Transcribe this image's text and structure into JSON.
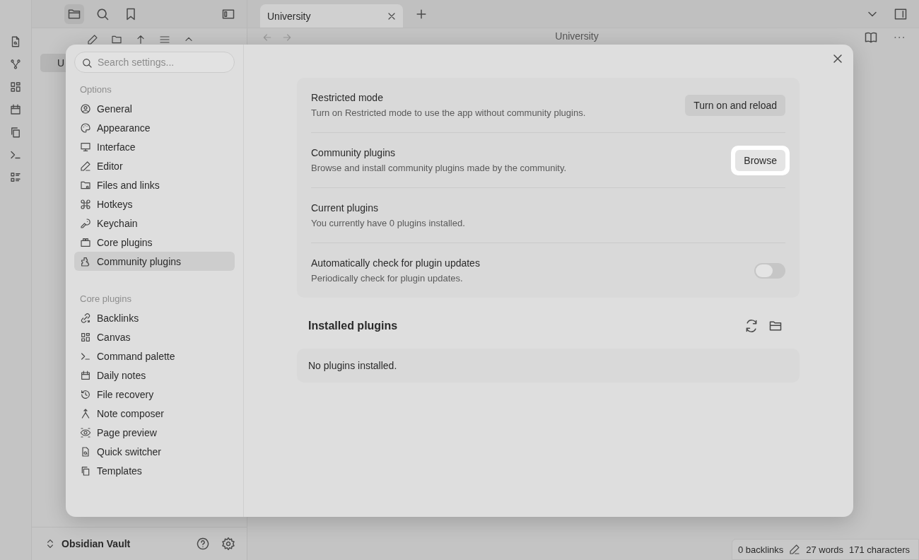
{
  "top_bar": {
    "tabs": [
      {
        "title": "University",
        "selected": true
      }
    ]
  },
  "view_header": {
    "title": "University"
  },
  "file_tree": [
    {
      "label": "U",
      "selected": true
    }
  ],
  "vault": {
    "name": "Obsidian Vault"
  },
  "status_bar": [
    "0 backlinks",
    "27 words",
    "171 characters"
  ],
  "settings": {
    "search": {
      "placeholder": "Search settings..."
    },
    "groups": [
      {
        "heading": "Options",
        "items": [
          {
            "label": "General",
            "selected": false
          },
          {
            "label": "Appearance",
            "selected": false
          },
          {
            "label": "Interface",
            "selected": false
          },
          {
            "label": "Editor",
            "selected": false
          },
          {
            "label": "Files and links",
            "selected": false
          },
          {
            "label": "Hotkeys",
            "selected": false
          },
          {
            "label": "Keychain",
            "selected": false
          },
          {
            "label": "Core plugins",
            "selected": false
          },
          {
            "label": "Community plugins",
            "selected": true
          }
        ]
      },
      {
        "heading": "Core plugins",
        "items": [
          {
            "label": "Backlinks",
            "selected": false
          },
          {
            "label": "Canvas",
            "selected": false
          },
          {
            "label": "Command palette",
            "selected": false
          },
          {
            "label": "Daily notes",
            "selected": false
          },
          {
            "label": "File recovery",
            "selected": false
          },
          {
            "label": "Note composer",
            "selected": false
          },
          {
            "label": "Page preview",
            "selected": false
          },
          {
            "label": "Quick switcher",
            "selected": false
          },
          {
            "label": "Templates",
            "selected": false
          }
        ]
      }
    ],
    "sections": [
      {
        "name": "Restricted mode",
        "description": "Turn on Restricted mode to use the app without community plugins.",
        "control": {
          "kind": "button",
          "label": "Turn on and reload",
          "highlighted": false
        }
      },
      {
        "name": "Community plugins",
        "description": "Browse and install community plugins made by the community.",
        "control": {
          "kind": "button",
          "label": "Browse",
          "highlighted": true
        }
      },
      {
        "name": "Current plugins",
        "description": "You currently have 0 plugins installed.",
        "control": {
          "kind": "none"
        }
      },
      {
        "name": "Automatically check for plugin updates",
        "description": "Periodically check for plugin updates.",
        "control": {
          "kind": "toggle",
          "on": false
        }
      }
    ],
    "installed": {
      "heading": "Installed plugins",
      "empty_text": "No plugins installed."
    }
  }
}
